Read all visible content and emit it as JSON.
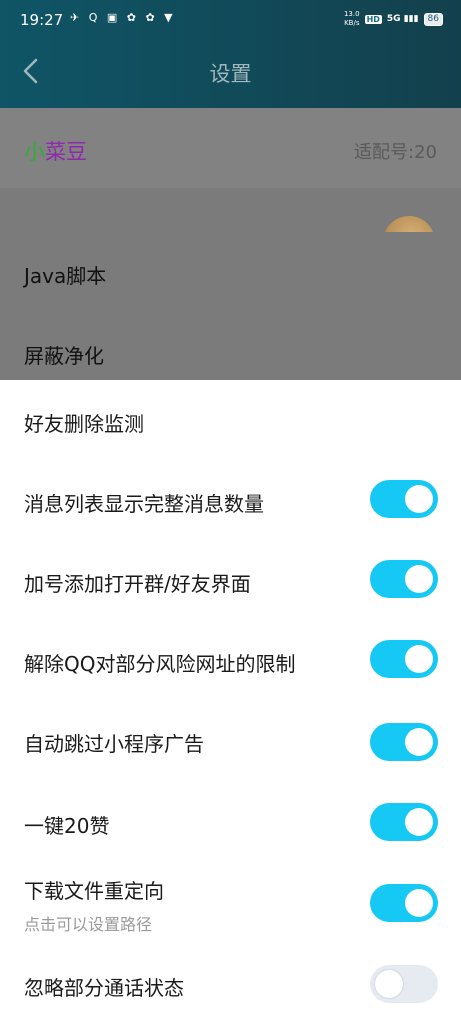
{
  "status_bar": {
    "time": "19:27",
    "left_icons": "✈ Q ▣ ✿ ✿ ▼",
    "net_speed_top": "13.0",
    "net_speed_bottom": "KB/s",
    "hd": "HD",
    "signal": "5G ▮▮▮",
    "battery": "86"
  },
  "header": {
    "title": "设置"
  },
  "user": {
    "name_part1": "小",
    "name_part2": "菜豆",
    "version": "适配号:20"
  },
  "dimmed_items": [
    "Java脚本",
    "屏蔽净化"
  ],
  "sheet": {
    "items": [
      {
        "label": "好友删除监测"
      },
      {
        "label": "消息列表显示完整消息数量",
        "toggle": "on"
      },
      {
        "label": "加号添加打开群/好友界面",
        "toggle": "on"
      },
      {
        "label": "解除QQ对部分风险网址的限制",
        "toggle": "on"
      },
      {
        "label": "自动跳过小程序广告",
        "toggle": "on"
      },
      {
        "label": "一键20赞",
        "toggle": "on"
      },
      {
        "label": "下载文件重定向",
        "sub": "点击可以设置路径",
        "toggle": "on"
      },
      {
        "label": "忽略部分通话状态",
        "toggle": "off"
      }
    ]
  },
  "colors": {
    "toggle_on": "#16c9f5",
    "toggle_off": "#e6eaf1",
    "header": "#0f5566"
  }
}
